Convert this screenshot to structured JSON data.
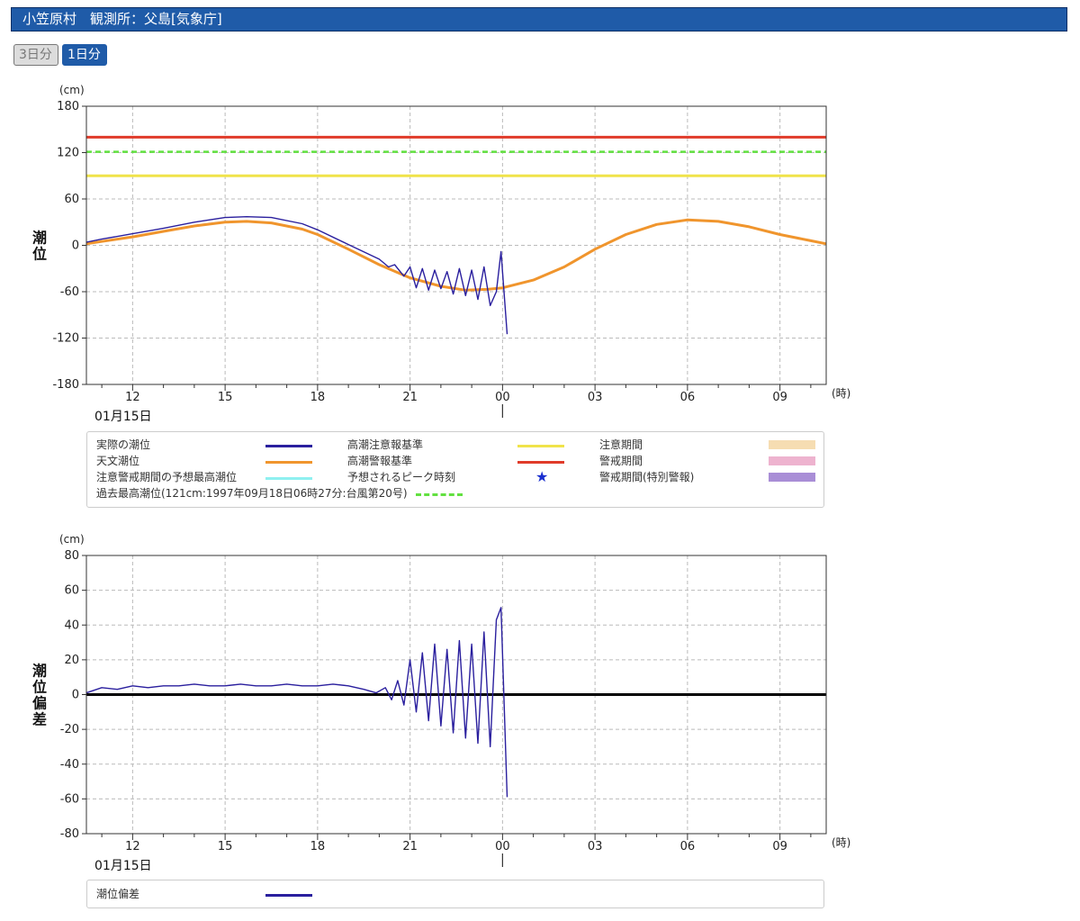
{
  "header": {
    "title": "小笠原村　観測所：父島[気象庁]"
  },
  "range_buttons": {
    "three_day": "3日分",
    "one_day": "1日分"
  },
  "tide_chart": {
    "unit": "(cm)",
    "ylabel": "潮\n位",
    "hour_unit": "(時)",
    "date_label": "01月15日"
  },
  "deviation_chart": {
    "unit": "(cm)",
    "ylabel": "潮\n位\n偏\n差",
    "hour_unit": "(時)",
    "date_label": "01月15日"
  },
  "legend_tide": {
    "items": [
      {
        "label": "実際の潮位",
        "color": "#2a1f9e",
        "kind": "line"
      },
      {
        "label": "天文潮位",
        "color": "#f0952d",
        "kind": "line"
      },
      {
        "label": "注意警戒期間の予想最高潮位",
        "color": "#8ff0f0",
        "kind": "line"
      },
      {
        "label": "過去最高潮位(121cm:1997年09月18日06時27分:台風第20号)",
        "color": "#62e040",
        "kind": "dash"
      },
      {
        "label": "高潮注意報基準",
        "color": "#f0e34a",
        "kind": "line"
      },
      {
        "label": "高潮警報基準",
        "color": "#e03b2a",
        "kind": "line"
      },
      {
        "label": "予想されるピーク時刻",
        "color": "#1a2fcf",
        "kind": "star"
      },
      {
        "label": "注意期間",
        "color": "#f6ddb2",
        "kind": "box"
      },
      {
        "label": "警戒期間",
        "color": "#eeb3cf",
        "kind": "box"
      },
      {
        "label": "警戒期間(特別警報)",
        "color": "#a98ed6",
        "kind": "box"
      }
    ]
  },
  "legend_deviation": {
    "items": [
      {
        "label": "潮位偏差",
        "color": "#2a1f9e",
        "kind": "line"
      }
    ]
  },
  "chart_data": [
    {
      "type": "line",
      "title": "",
      "ylabel": "潮位",
      "y_unit": "cm",
      "ylim": [
        -180,
        180
      ],
      "yticks": [
        180,
        120,
        60,
        0,
        -60,
        -120,
        -180
      ],
      "x_unit": "時",
      "xlim_hours": [
        10.5,
        34.5
      ],
      "xticks": [
        {
          "hour": 12,
          "label": "12"
        },
        {
          "hour": 15,
          "label": "15"
        },
        {
          "hour": 18,
          "label": "18"
        },
        {
          "hour": 21,
          "label": "21"
        },
        {
          "hour": 24,
          "label": "00"
        },
        {
          "hour": 27,
          "label": "03"
        },
        {
          "hour": 30,
          "label": "06"
        },
        {
          "hour": 33,
          "label": "09"
        }
      ],
      "date_marker": {
        "hour": 24,
        "label": "01月15日"
      },
      "grid": true,
      "thresholds": [
        {
          "name": "高潮警報基準",
          "value": 140,
          "color": "#e03b2a",
          "style": "solid"
        },
        {
          "name": "過去最高潮位",
          "value": 121,
          "color": "#62e040",
          "style": "dashed"
        },
        {
          "name": "高潮注意報基準",
          "value": 90,
          "color": "#f0e34a",
          "style": "solid"
        }
      ],
      "series": [
        {
          "name": "天文潮位",
          "color": "#f0952d",
          "x": [
            10.5,
            11,
            12,
            13,
            14,
            15,
            15.7,
            16.5,
            17.5,
            18,
            19,
            20,
            21,
            22,
            22.8,
            23.5,
            24,
            25,
            26,
            27,
            28,
            29,
            30,
            31,
            32,
            33,
            34,
            34.5
          ],
          "y": [
            2,
            5,
            11,
            18,
            25,
            30,
            31,
            29,
            21,
            14,
            -5,
            -25,
            -42,
            -53,
            -58,
            -57,
            -55,
            -45,
            -28,
            -5,
            14,
            27,
            33,
            31,
            24,
            14,
            6,
            2
          ]
        },
        {
          "name": "実際の潮位",
          "color": "#2a1f9e",
          "x": [
            10.5,
            11,
            12,
            13,
            14,
            15,
            15.7,
            16.5,
            17.5,
            18,
            19,
            20,
            20.3,
            20.5,
            20.8,
            21,
            21.2,
            21.4,
            21.6,
            21.8,
            22,
            22.2,
            22.4,
            22.6,
            22.8,
            23,
            23.2,
            23.4,
            23.6,
            23.8,
            23.95,
            24.15
          ],
          "y": [
            4,
            8,
            15,
            22,
            30,
            36,
            37,
            36,
            28,
            20,
            1,
            -18,
            -28,
            -25,
            -40,
            -28,
            -55,
            -30,
            -58,
            -32,
            -56,
            -34,
            -63,
            -30,
            -65,
            -32,
            -70,
            -28,
            -78,
            -60,
            -8,
            -115
          ]
        }
      ]
    },
    {
      "type": "line",
      "title": "",
      "ylabel": "潮位偏差",
      "y_unit": "cm",
      "ylim": [
        -80,
        80
      ],
      "yticks": [
        80,
        60,
        40,
        20,
        0,
        -20,
        -40,
        -60,
        -80
      ],
      "x_unit": "時",
      "xlim_hours": [
        10.5,
        34.5
      ],
      "xticks": [
        {
          "hour": 12,
          "label": "12"
        },
        {
          "hour": 15,
          "label": "15"
        },
        {
          "hour": 18,
          "label": "18"
        },
        {
          "hour": 21,
          "label": "21"
        },
        {
          "hour": 24,
          "label": "00"
        },
        {
          "hour": 27,
          "label": "03"
        },
        {
          "hour": 30,
          "label": "06"
        },
        {
          "hour": 33,
          "label": "09"
        }
      ],
      "date_marker": {
        "hour": 24,
        "label": "01月15日"
      },
      "grid": true,
      "series": [
        {
          "name": "潮位偏差",
          "color": "#2a1f9e",
          "x": [
            10.5,
            11,
            11.5,
            12,
            12.5,
            13,
            13.5,
            14,
            14.5,
            15,
            15.5,
            16,
            16.5,
            17,
            17.5,
            18,
            18.5,
            19,
            19.5,
            19.9,
            20.2,
            20.4,
            20.6,
            20.8,
            21,
            21.2,
            21.4,
            21.6,
            21.8,
            22,
            22.2,
            22.4,
            22.6,
            22.8,
            23,
            23.2,
            23.4,
            23.6,
            23.8,
            23.95,
            24.15
          ],
          "y": [
            1,
            4,
            3,
            5,
            4,
            5,
            5,
            6,
            5,
            5,
            6,
            5,
            5,
            6,
            5,
            5,
            6,
            5,
            3,
            1,
            4,
            -3,
            8,
            -6,
            20,
            -10,
            24,
            -15,
            29,
            -18,
            26,
            -22,
            31,
            -25,
            29,
            -28,
            36,
            -30,
            43,
            50,
            -59
          ]
        }
      ]
    }
  ]
}
